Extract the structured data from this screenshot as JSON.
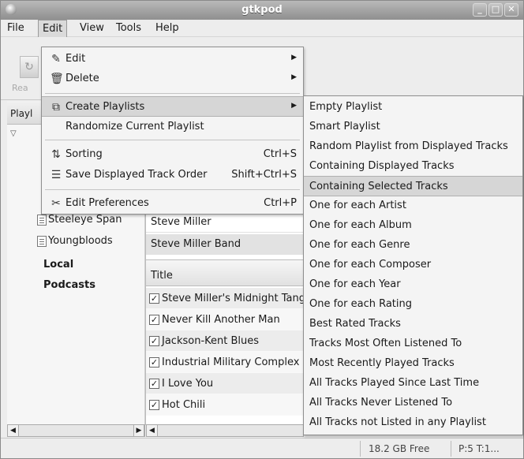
{
  "window": {
    "title": "gtkpod"
  },
  "menubar": {
    "items": [
      "File",
      "Edit",
      "View",
      "Tools",
      "Help"
    ]
  },
  "toolbar": {
    "read_label": "Rea"
  },
  "playlists": {
    "header": "Playl",
    "items": [
      "Steeleye Span",
      "Youngbloods"
    ],
    "sections": [
      "Local",
      "Podcasts"
    ]
  },
  "artists": [
    "Steve Miller",
    "Steve Miller Band"
  ],
  "tracks": {
    "column_title": "Title",
    "rows": [
      "Steve Miller's Midnight Tango",
      "Never Kill Another Man",
      "Jackson-Kent Blues",
      "Industrial Military Complex",
      "I Love You",
      "Hot Chili"
    ]
  },
  "status": {
    "free": "18.2 GB Free",
    "pending": "P:5 T:1..."
  },
  "edit_menu": {
    "edit": "Edit",
    "delete": "Delete",
    "create_playlists": "Create Playlists",
    "randomize": "Randomize Current Playlist",
    "sorting": "Sorting",
    "sorting_shortcut": "Ctrl+S",
    "save_order": "Save Displayed Track Order",
    "save_order_shortcut": "Shift+Ctrl+S",
    "preferences": "Edit Preferences",
    "preferences_shortcut": "Ctrl+P"
  },
  "create_submenu": [
    "Empty Playlist",
    "Smart Playlist",
    "Random Playlist from Displayed Tracks",
    "Containing Displayed Tracks",
    "Containing Selected Tracks",
    "One for each Artist",
    "One for each Album",
    "One for each Genre",
    "One for each Composer",
    "One for each Year",
    "One for each Rating",
    "Best Rated Tracks",
    "Tracks Most Often Listened To",
    "Most Recently Played Tracks",
    "All Tracks Played Since Last Time",
    "All Tracks Never Listened To",
    "All Tracks not Listed in any Playlist"
  ]
}
